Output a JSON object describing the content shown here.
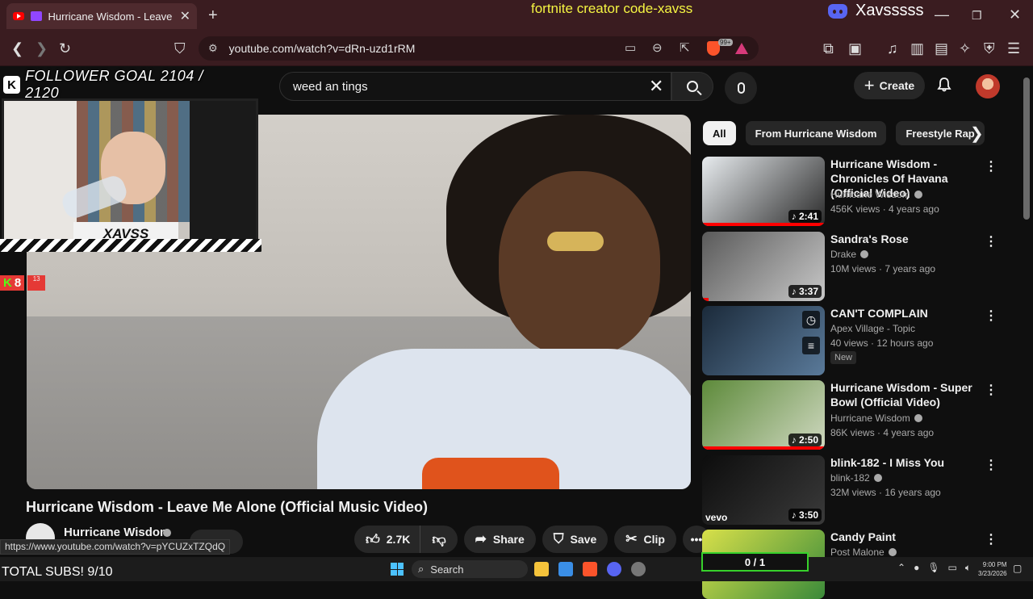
{
  "browser": {
    "tab_title": "Hurricane Wisdom - Leave Me Alone (Official Music Video)",
    "new_tab_icon": "+",
    "url": "youtube.com/watch?v=dRn-uzd1rRM",
    "shield_badge": "99+",
    "status_url": "https://www.youtube.com/watch?v=pYCUZxTZQdQ"
  },
  "overlay": {
    "creator_code": "fortnite creator code-xavss",
    "follower_goal": "FOLLOWER GOAL 2104 / 2120",
    "webcam_label": "XAVSS",
    "kick_viewers": "8",
    "kick_badge_small": "13",
    "total_subs": "TOTAL SUBS! 9/10",
    "sub_counter": "0 / 1"
  },
  "discord": {
    "username": "Xavsssss"
  },
  "youtube": {
    "search_query": "weed an tings",
    "create_label": "Create",
    "video_title": "Hurricane Wisdom - Leave Me Alone (Official Music Video)",
    "channel_name": "Hurricane Wisdom",
    "actions": {
      "likes": "2.7K",
      "share": "Share",
      "save": "Save",
      "clip": "Clip"
    },
    "chips": [
      "All",
      "From Hurricane Wisdom",
      "Freestyle Rap"
    ],
    "recommendations": [
      {
        "title": "Hurricane Wisdom - Chronicles Of Havana (Official Video)",
        "channel": "Hurricane Wisdom",
        "verified": true,
        "meta": "456K views · 4 years ago",
        "duration": "♪ 2:41",
        "progress": 1.0,
        "thumb_colors": [
          "#e8ecef",
          "#2a2a2a"
        ]
      },
      {
        "title": "Sandra's Rose",
        "channel": "Drake",
        "verified": true,
        "meta": "10M views · 7 years ago",
        "duration": "♪ 3:37",
        "progress": 0.05,
        "thumb_colors": [
          "#5a5a5a",
          "#c8c8c8"
        ]
      },
      {
        "title": "CAN'T COMPLAIN",
        "channel": "Apex Village - Topic",
        "verified": false,
        "meta": "40 views · 12 hours ago",
        "badge": "New",
        "duration": "",
        "progress": 0,
        "thumb_colors": [
          "#1b2a3a",
          "#5a7a9a"
        ]
      },
      {
        "title": "Hurricane Wisdom - Super Bowl (Official Video)",
        "channel": "Hurricane Wisdom",
        "verified": true,
        "meta": "86K views · 4 years ago",
        "duration": "♪ 2:50",
        "progress": 1.0,
        "thumb_colors": [
          "#5d8a3a",
          "#cfd8c0"
        ]
      },
      {
        "title": "blink-182 - I Miss You",
        "channel": "blink-182",
        "verified": true,
        "meta": "32M views · 16 years ago",
        "duration": "♪ 3:50",
        "progress": 0,
        "thumb_colors": [
          "#0d0d0d",
          "#3a3a3a"
        ],
        "watermark": "vevo"
      },
      {
        "title": "Candy Paint",
        "channel": "Post Malone",
        "verified": true,
        "meta": "",
        "duration": "",
        "progress": 0,
        "thumb_colors": [
          "#d8e04a",
          "#3a8a3a"
        ]
      }
    ]
  },
  "taskbar": {
    "search_label": "Search",
    "time": "9:00 PM",
    "date": "3/23/2026"
  },
  "colors": {
    "accent_red": "#ff0000",
    "frame_bg": "#3a1c20",
    "counter_green": "#37d12b"
  }
}
